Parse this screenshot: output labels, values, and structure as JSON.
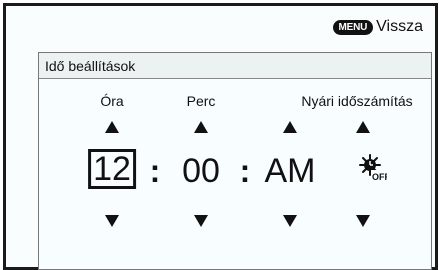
{
  "top_bar": {
    "menu_badge": "MENU",
    "back_label": "Vissza"
  },
  "panel": {
    "title": "Idő beállítások",
    "columns": {
      "hour_label": "Óra",
      "minute_label": "Perc",
      "dst_label": "Nyári időszámítás"
    },
    "values": {
      "hour": "12",
      "separator1": ":",
      "minute": "00",
      "separator2": ":",
      "ampm": "AM"
    },
    "dst_icon": "sun-clock-off-icon",
    "dst_icon_text": "OFF"
  }
}
